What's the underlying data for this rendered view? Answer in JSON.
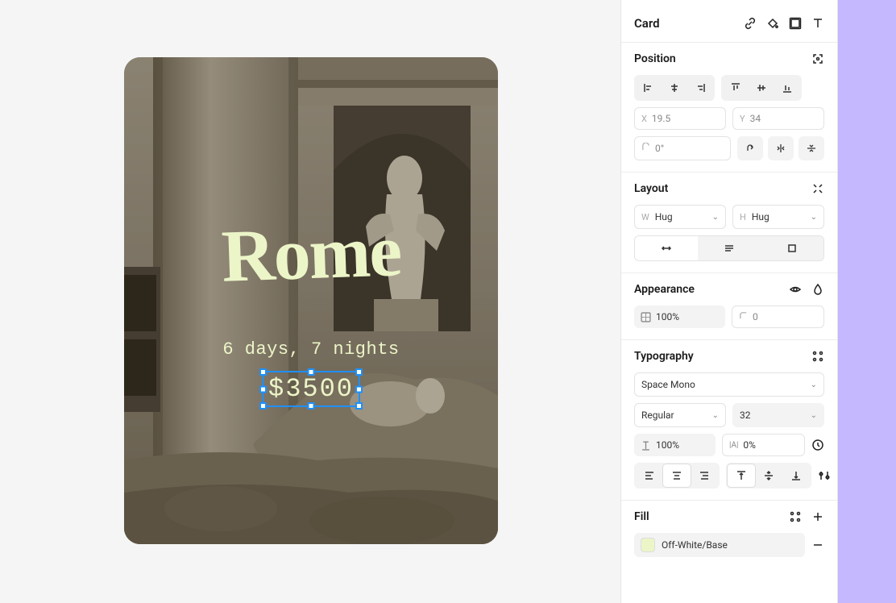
{
  "card": {
    "title": "Rome",
    "subtitle": "6 days, 7 nights",
    "price": "$3500"
  },
  "panel": {
    "element_label": "Card",
    "position": {
      "label": "Position",
      "x_prefix": "X",
      "x_value": "19.5",
      "y_prefix": "Y",
      "y_value": "34",
      "rotation_value": "0°"
    },
    "layout": {
      "label": "Layout",
      "w_prefix": "W",
      "w_value": "Hug",
      "h_prefix": "H",
      "h_value": "Hug"
    },
    "appearance": {
      "label": "Appearance",
      "opacity_value": "100%",
      "radius_value": "0"
    },
    "typography": {
      "label": "Typography",
      "font_family": "Space Mono",
      "weight": "Regular",
      "size": "32",
      "line_height": "100%",
      "letter_spacing": "0%"
    },
    "fill": {
      "label": "Fill",
      "color_name": "Off-White/Base",
      "swatch_hex": "#ecf5c8"
    }
  }
}
